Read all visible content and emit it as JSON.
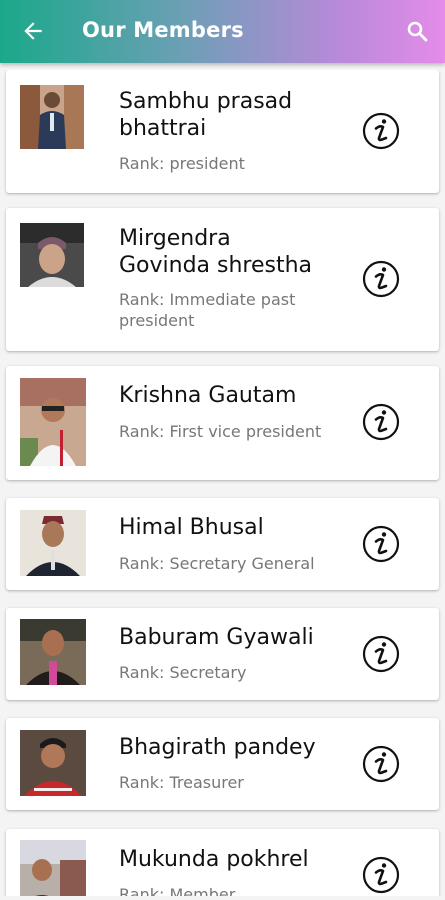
{
  "appbar": {
    "title": "Our Members",
    "back_icon": "arrow-left-icon",
    "search_icon": "search-icon",
    "colors": [
      "#1aa88a",
      "#e48ce8"
    ]
  },
  "members": [
    {
      "name": "Sambhu prasad bhattrai",
      "rank": "Rank: president"
    },
    {
      "name": "Mirgendra Govinda shrestha",
      "rank": "Rank: Immediate past president"
    },
    {
      "name": "Krishna Gautam",
      "rank": "Rank: First vice president"
    },
    {
      "name": "Himal Bhusal",
      "rank": "Rank: Secretary General"
    },
    {
      "name": "Baburam Gyawali",
      "rank": "Rank: Secretary"
    },
    {
      "name": "Bhagirath pandey",
      "rank": "Rank: Treasurer"
    },
    {
      "name": "Mukunda pokhrel",
      "rank": "Rank: Member"
    }
  ],
  "info_icon": "info-icon"
}
